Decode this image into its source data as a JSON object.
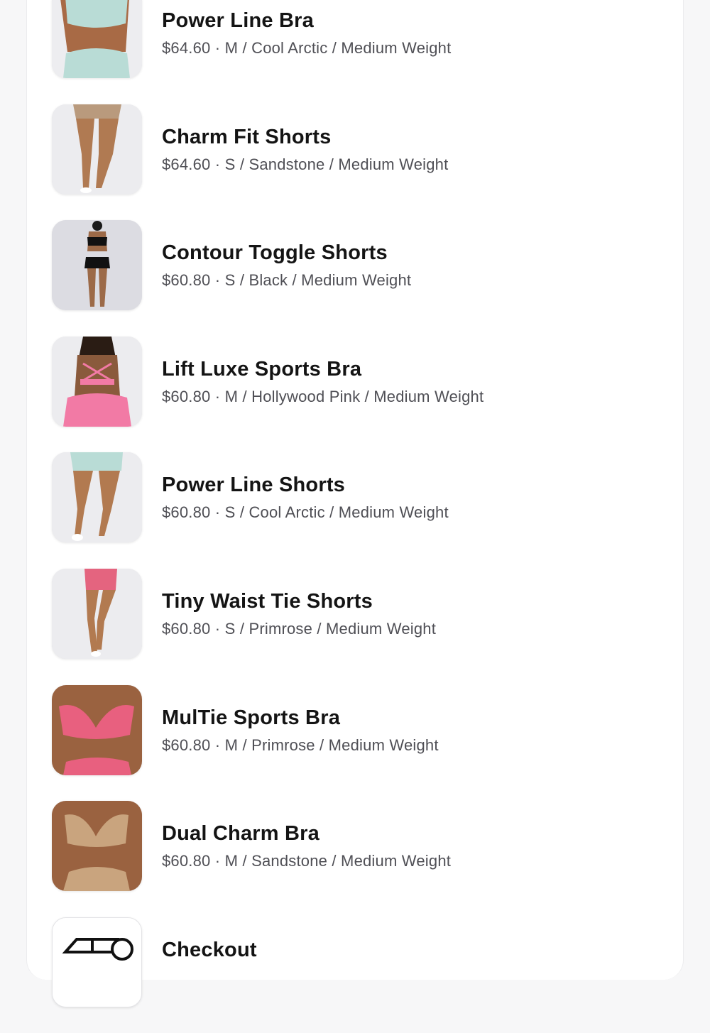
{
  "items": [
    {
      "name": "Power Line Bra",
      "details": "$64.60 · M / Cool Arctic / Medium Weight",
      "image": "product-photo",
      "tone": "#b9dcd6",
      "skin": "#a86a45"
    },
    {
      "name": "Charm Fit Shorts",
      "details": "$64.60 · S / Sandstone / Medium Weight",
      "image": "product-photo",
      "tone": "#b99a7d",
      "skin": "#b07a52"
    },
    {
      "name": "Contour Toggle Shorts",
      "details": "$60.80 · S / Black / Medium Weight",
      "image": "product-photo",
      "tone": "#111111",
      "skin": "#9c6a48"
    },
    {
      "name": "Lift Luxe Sports Bra",
      "details": "$60.80 · M / Hollywood Pink / Medium Weight",
      "image": "product-photo",
      "tone": "#f27aa5",
      "skin": "#8a5a3c"
    },
    {
      "name": "Power Line Shorts",
      "details": "$60.80 · S / Cool Arctic / Medium Weight",
      "image": "product-photo",
      "tone": "#b9dcd6",
      "skin": "#b27a50"
    },
    {
      "name": "Tiny Waist Tie Shorts",
      "details": "$60.80 · S / Primrose / Medium Weight",
      "image": "product-photo",
      "tone": "#e4647f",
      "skin": "#b27a50"
    },
    {
      "name": "MulTie Sports Bra",
      "details": "$60.80 · M / Primrose / Medium Weight",
      "image": "product-photo",
      "tone": "#e8607f",
      "skin": "#9a6240"
    },
    {
      "name": "Dual Charm Bra",
      "details": "$60.80 · M / Sandstone / Medium Weight",
      "image": "product-photo",
      "tone": "#c9a47e",
      "skin": "#9a6240"
    }
  ],
  "checkout": {
    "label": "Checkout",
    "icon": "delivery-truck-icon"
  }
}
